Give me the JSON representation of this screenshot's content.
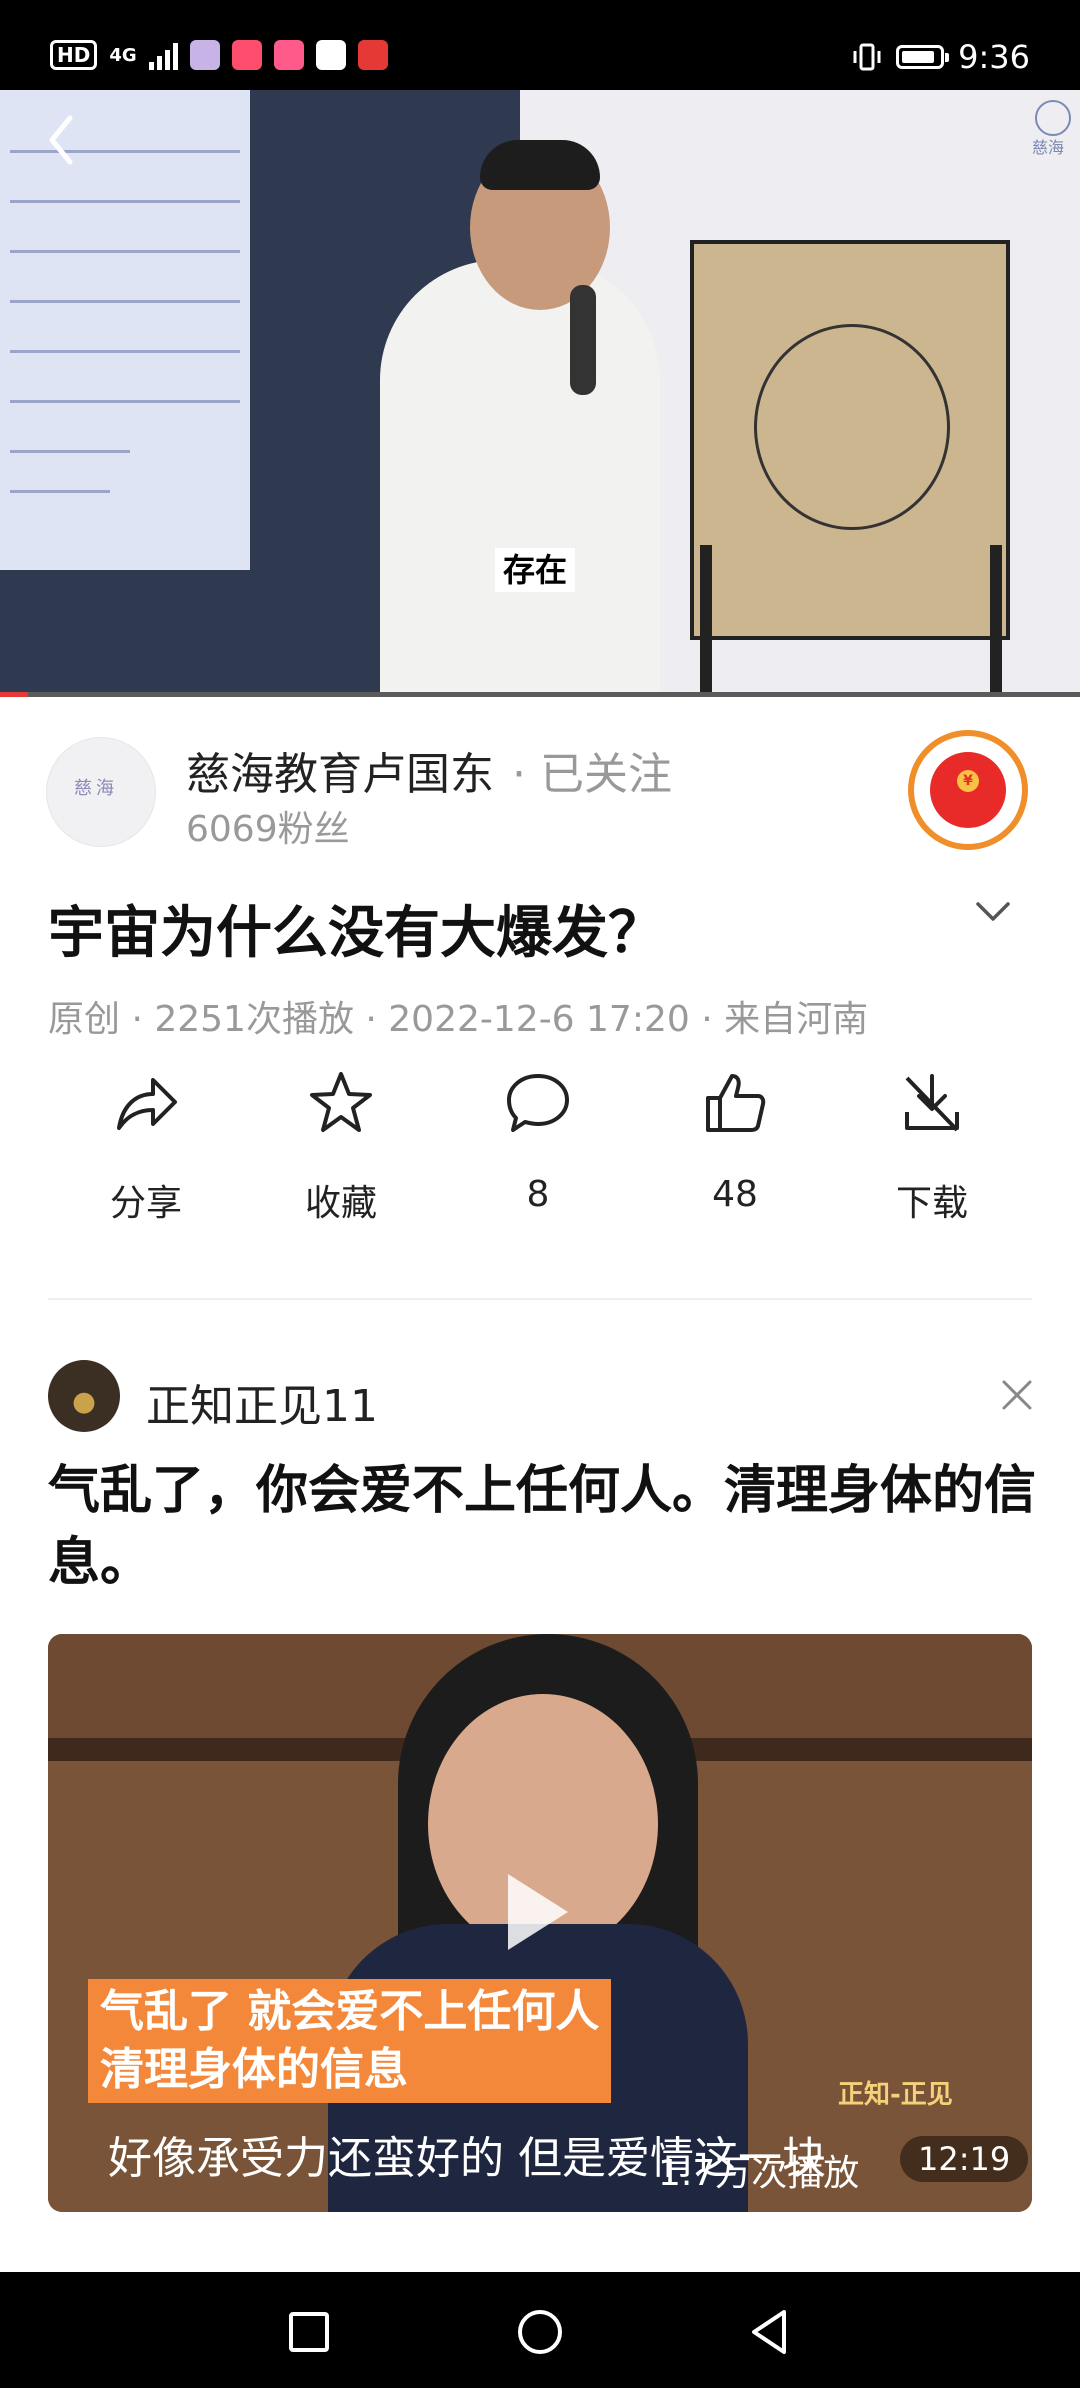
{
  "status_bar": {
    "hd": "HD",
    "network": "4G",
    "time": "9:36"
  },
  "video": {
    "caption": "存在",
    "watermark": "慈海"
  },
  "author": {
    "avatar_text": "慈海",
    "name": "慈海教育卢国东",
    "follow_status": "· 已关注",
    "fans": "6069粉丝"
  },
  "post": {
    "title": "宇宙为什么没有大爆发？",
    "meta": "原创 · 2251次播放 · 2022-12-6 17:20 · 来自河南"
  },
  "actions": {
    "share": "分享",
    "favorite": "收藏",
    "comments": "8",
    "likes": "48",
    "download": "下载"
  },
  "recommendation": {
    "author": "正知正见11",
    "title": "气乱了，你会爱不上任何人。清理身体的信息。",
    "banner_line1": "气乱了  就会爱不上任何人",
    "banner_line2": "清理身体的信息",
    "brand": "正知-正见",
    "subtitle": "好像承受力还蛮好的 但是爱情这一块",
    "views": "1.7万次播放",
    "duration": "12:19"
  },
  "colors": {
    "accent_red": "#e82b29",
    "ring_orange": "#f08e2a",
    "muted": "#999999"
  }
}
